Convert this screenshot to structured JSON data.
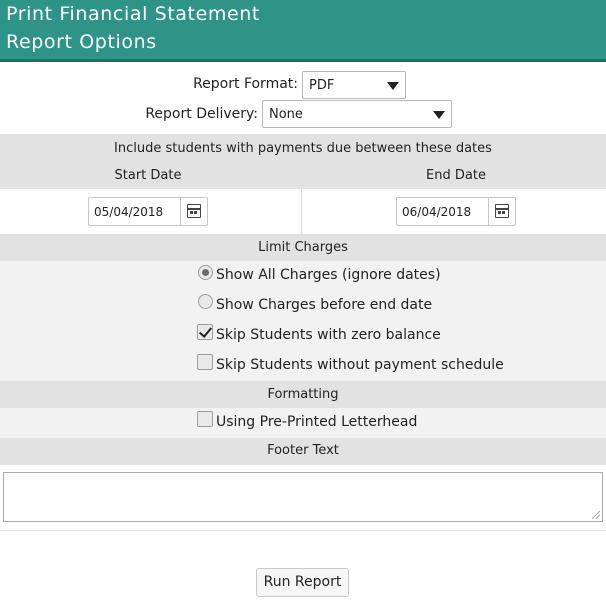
{
  "window": {
    "title_line1": "Print Financial Statement",
    "title_line2": "Report Options"
  },
  "report": {
    "format_label": "Report Format:",
    "format_value": "PDF",
    "delivery_label": "Report Delivery:",
    "delivery_value": "None"
  },
  "dates": {
    "heading": "Include students with payments due between these dates",
    "start_label": "Start Date",
    "end_label": "End Date",
    "start_value": "05/04/2018",
    "end_value": "06/04/2018"
  },
  "limit_charges": {
    "heading": "Limit Charges",
    "options": [
      {
        "label": "Show All Charges (ignore dates)",
        "type": "radio",
        "checked": true
      },
      {
        "label": "Show Charges before end date",
        "type": "radio",
        "checked": false
      },
      {
        "label": "Skip Students with zero balance",
        "type": "checkbox",
        "checked": true
      },
      {
        "label": "Skip Students without payment schedule",
        "type": "checkbox",
        "checked": false
      }
    ]
  },
  "formatting": {
    "heading": "Formatting",
    "letterhead_label": "Using Pre-Printed Letterhead",
    "letterhead_checked": false
  },
  "footer": {
    "heading": "Footer Text",
    "value": ""
  },
  "actions": {
    "run_label": "Run Report"
  },
  "colors": {
    "title_bar": "#2f9488",
    "band": "#e2e2e2",
    "band_light": "#f2f2f2"
  }
}
